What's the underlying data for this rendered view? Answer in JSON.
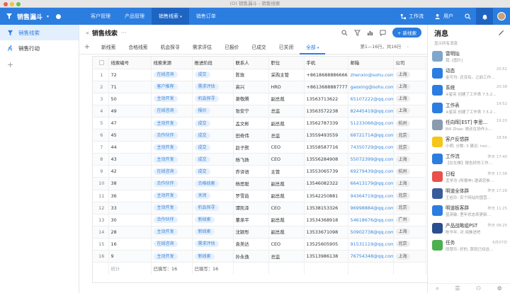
{
  "window": {
    "title": "(O) 销售漏斗 - 销售线索"
  },
  "appbar": {
    "brand": "销售漏斗",
    "tabs": [
      {
        "label": "客户管理",
        "active": false
      },
      {
        "label": "产品管理",
        "active": false
      },
      {
        "label": "销售线索",
        "active": true
      },
      {
        "label": "销售订单",
        "active": false
      }
    ],
    "workflow": "工作流",
    "users": "用户",
    "accent": "#2b7de0"
  },
  "sidebar": {
    "items": [
      {
        "label": "销售线索",
        "icon": "funnel-icon",
        "active": true
      },
      {
        "label": "销售行动",
        "icon": "runner-icon",
        "active": false
      }
    ]
  },
  "main": {
    "title": "销售线索",
    "new_button": "+ 新线索",
    "tabs": [
      "新线索",
      "合格线索",
      "机会探寻",
      "需求评估",
      "已报价",
      "已成交",
      "已关闭",
      "全部"
    ],
    "active_tab": "全部",
    "pager": "第1—16行，共16行",
    "columns": [
      "线索编号",
      "线索来源",
      "推进阶段",
      "联系人",
      "职位",
      "手机",
      "邮箱",
      "公司"
    ],
    "rows": [
      [
        "72",
        "在线咨询",
        "成交",
        "陈玫",
        "采购主管",
        "+8618688886666",
        "zhenxin@sohu.com",
        "上海"
      ],
      [
        "71",
        "客户推荐",
        "需求评估",
        "高兴",
        "HRD",
        "+8613688887777",
        "gaoxing@sohu.com",
        "上海"
      ],
      [
        "50",
        "主动开发",
        "机会探寻",
        "萧敬腾",
        "副总裁",
        "13563713622",
        "65107222@qq.com",
        "上海"
      ],
      [
        "49",
        "在线咨询",
        "报价",
        "张安宁",
        "总监",
        "13563572238",
        "82445419@qq.com",
        "上海"
      ],
      [
        "47",
        "主动开发",
        "成交",
        "孟文彬",
        "副总裁",
        "13562787339",
        "51233066@qq.com",
        "杭州"
      ],
      [
        "45",
        "合作伙伴",
        "成交",
        "田奇伟",
        "总监",
        "13559493559",
        "68721714@qq.com",
        "北京"
      ],
      [
        "44",
        "主动开发",
        "成交",
        "赵子默",
        "CEO",
        "13558587716",
        "74350729@qq.com",
        "北京"
      ],
      [
        "43",
        "主动开发",
        "成交",
        "杨飞扬",
        "CEO",
        "13556284908",
        "55072399@qq.com",
        "上海"
      ],
      [
        "42",
        "在线咨询",
        "成交",
        "乔译语",
        "主管",
        "13553065739",
        "69279439@qq.com",
        "杭州"
      ],
      [
        "38",
        "合作伙伴",
        "合格线索",
        "杨思聪",
        "副总裁",
        "13546082322",
        "66413179@qq.com",
        "上海"
      ],
      [
        "36",
        "主动开发",
        "关闭",
        "罗雪茹",
        "副总裁",
        "13542250881",
        "94364719@qq.com",
        "北京"
      ],
      [
        "33",
        "主动开发",
        "机会探寻",
        "谭凯泽",
        "CEO",
        "13538153326",
        "96998884@qq.com",
        "北京"
      ],
      [
        "30",
        "合作伙伴",
        "新线索",
        "董承平",
        "副总裁",
        "13534368918",
        "54618676@qq.com",
        "广州"
      ],
      [
        "28",
        "主动开发",
        "新线索",
        "沈颖彤",
        "副总裁",
        "13533671098",
        "50902738@qq.com",
        "上海"
      ],
      [
        "16",
        "在线咨询",
        "需求评估",
        "袁美达",
        "CEO",
        "13525605905",
        "91531119@qq.com",
        "北京"
      ],
      [
        "9",
        "主动开发",
        "新线索",
        "孙永逸",
        "总监",
        "13513986138",
        "76754348@qq.com",
        "上海"
      ]
    ],
    "footer": {
      "stat": "统计",
      "filled": "已填写：16"
    }
  },
  "messages": {
    "title": "消息",
    "subtitle": "显示所有消息",
    "items": [
      {
        "name": "雷明灿",
        "preview": "我: [图片]",
        "time": "",
        "color": "#7fa7c9",
        "icon": "avatar-photo"
      },
      {
        "name": "动态",
        "preview": "金可均: 还没有。之前工作…",
        "time": "20:52",
        "color": "#2b7de0",
        "icon": "bell-icon"
      },
      {
        "name": "系统",
        "preview": "※星亮 创建了工作表 7.5.2…",
        "time": "20:38",
        "color": "#2b7de0",
        "icon": "gear-icon"
      },
      {
        "name": "工作表",
        "preview": "※星亮 创建了工作表 7.5.2…",
        "time": "19:52",
        "color": "#2b7de0",
        "icon": "table-icon"
      },
      {
        "name": "任向晖[EST] 李思…",
        "preview": "Bill Zhao: 她还在协作上…",
        "time": "19:20",
        "color": "#8a9bb0",
        "icon": "avatar-group"
      },
      {
        "name": "客户反馈群",
        "preview": "小明, 分数: 3 建议: inci…",
        "time": "18:56",
        "color": "#f5c518",
        "icon": "smile-icon"
      },
      {
        "name": "工作流",
        "preview": "【在社推】报告好的工作…",
        "time": "昨天 17:40",
        "color": "#2b7de0",
        "icon": "flow-icon"
      },
      {
        "name": "日程",
        "preview": "孟学功 (所报申) 邀请您参…",
        "time": "昨天 17:38",
        "color": "#e8504a",
        "icon": "calendar-icon"
      },
      {
        "name": "明道全体群",
        "preview": "王岩玲: 实个网站的国营…",
        "time": "昨天 17:28",
        "color": "#3a5b9a",
        "icon": "group-icon"
      },
      {
        "name": "明道板客群",
        "preview": "蓝英敏: 里年状态来更新…",
        "time": "昨天 11:25",
        "color": "#2b7de0",
        "icon": "group-icon"
      },
      {
        "name": "产品战略组PST",
        "preview": "陈华年: 对 用推进吧",
        "time": "昨天 08:25",
        "color": "#2a4f8f",
        "icon": "pst-icon"
      },
      {
        "name": "任务",
        "preview": "段慧玲: 好的, 那就已经这…",
        "time": "6月07日",
        "color": "#4caf50",
        "icon": "check-icon"
      }
    ]
  }
}
